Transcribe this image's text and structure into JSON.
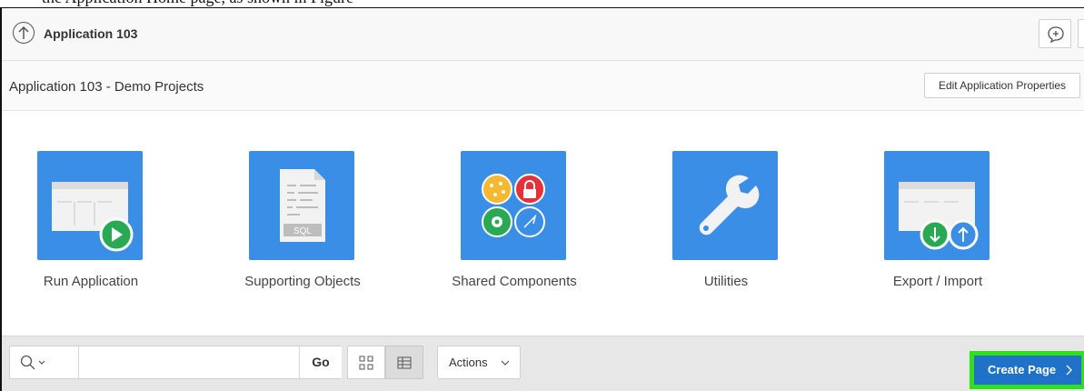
{
  "caption_fragment": "the Application Home page, as shown in Figure",
  "header": {
    "title": "Application 103"
  },
  "region": {
    "title": "Application 103 - Demo Projects",
    "edit_button": "Edit Application Properties"
  },
  "tiles": [
    {
      "label": "Run Application",
      "icon": "run-application-icon"
    },
    {
      "label": "Supporting Objects",
      "icon": "sql-script-icon"
    },
    {
      "label": "Shared Components",
      "icon": "shared-components-icon"
    },
    {
      "label": "Utilities",
      "icon": "wrench-icon"
    },
    {
      "label": "Export / Import",
      "icon": "export-import-icon"
    }
  ],
  "sql_badge": "SQL",
  "toolbar": {
    "search_value": "",
    "go_label": "Go",
    "actions_label": "Actions",
    "create_label": "Create Page",
    "active_view": "report"
  },
  "colors": {
    "tile_blue": "#3a8ee6",
    "create_button": "#1f72c8",
    "highlight": "#2fe01a",
    "play_green": "#2aa954"
  }
}
